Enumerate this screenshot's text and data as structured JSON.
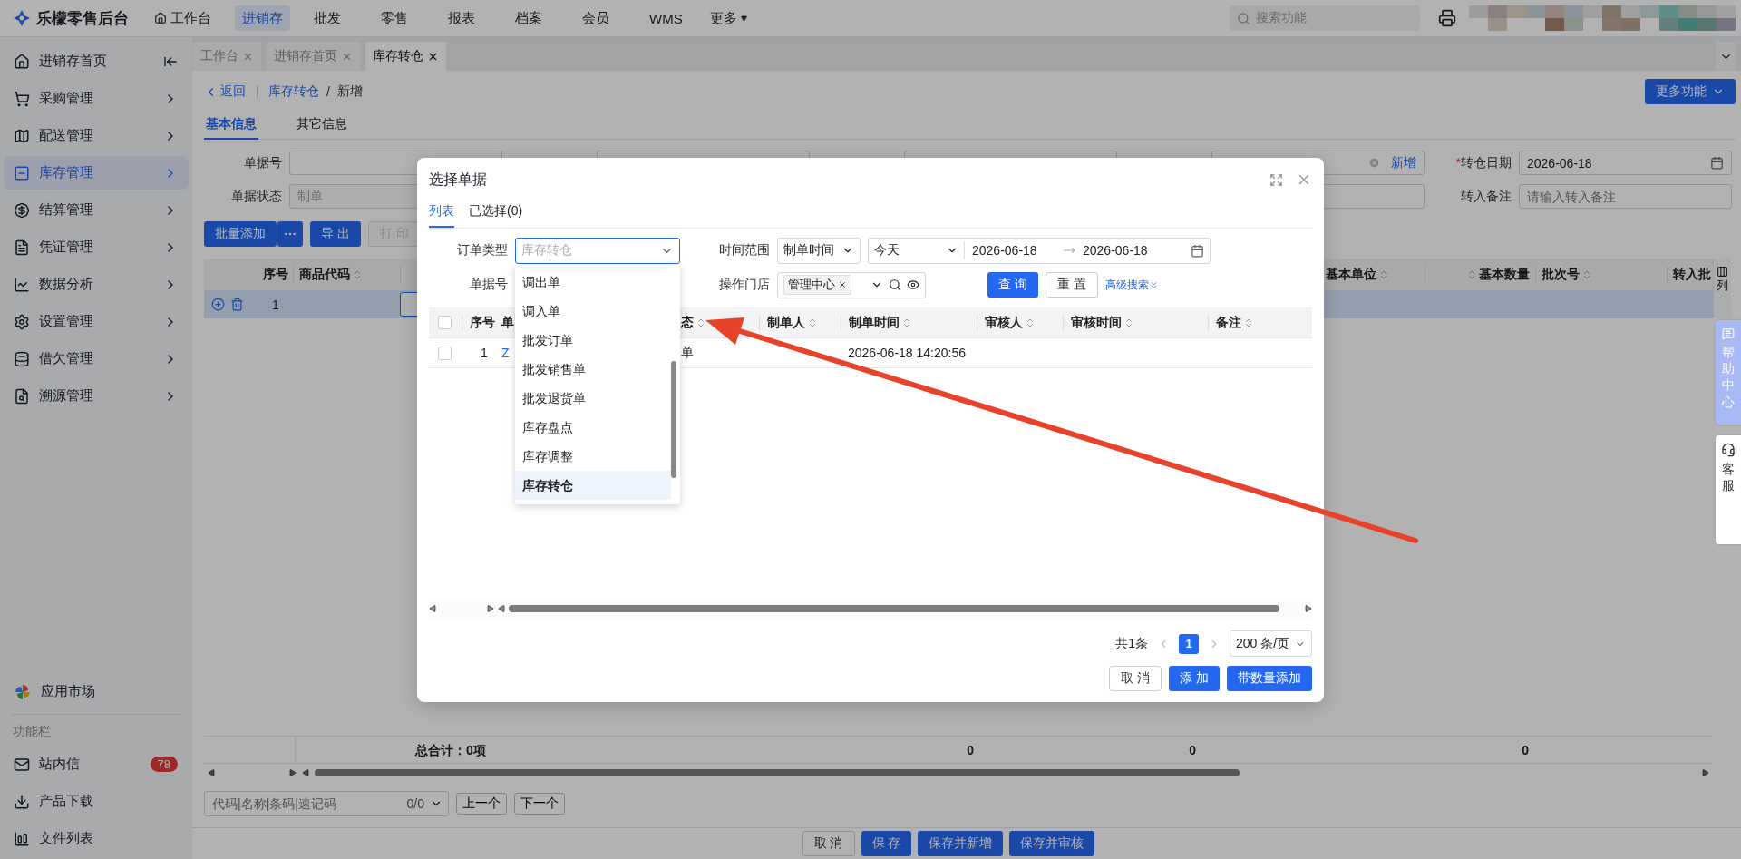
{
  "top_bar": {
    "logo_text": "乐檬零售后台",
    "nav": [
      {
        "label": "工作台",
        "selected": false
      },
      {
        "label": "进销存",
        "selected": true
      },
      {
        "label": "批发",
        "selected": false
      },
      {
        "label": "零售",
        "selected": false
      },
      {
        "label": "报表",
        "selected": false
      },
      {
        "label": "档案",
        "selected": false
      },
      {
        "label": "会员",
        "selected": false
      },
      {
        "label": "WMS",
        "selected": false
      },
      {
        "label": "更多",
        "selected": false
      }
    ],
    "search": {
      "placeholder": "搜索功能"
    }
  },
  "sidebar": {
    "items": [
      {
        "label": "进销存首页",
        "selected": false
      },
      {
        "label": "采购管理",
        "selected": false
      },
      {
        "label": "配送管理",
        "selected": false
      },
      {
        "label": "库存管理",
        "selected": true
      },
      {
        "label": "结算管理",
        "selected": false
      },
      {
        "label": "凭证管理",
        "selected": false
      },
      {
        "label": "数据分析",
        "selected": false
      },
      {
        "label": "设置管理",
        "selected": false
      },
      {
        "label": "借欠管理",
        "selected": false
      },
      {
        "label": "溯源管理",
        "selected": false
      }
    ],
    "app_market": "应用市场",
    "section_title": "功能栏",
    "tools": [
      {
        "label": "站内信",
        "badge": "78"
      },
      {
        "label": "产品下载"
      },
      {
        "label": "文件列表"
      }
    ]
  },
  "page_tabs": [
    {
      "label": "工作台",
      "selected": false
    },
    {
      "label": "进销存首页",
      "selected": false
    },
    {
      "label": "库存转仓",
      "selected": true
    }
  ],
  "breadcrumb": {
    "back": "返回",
    "parent": "库存转仓",
    "separator": "/",
    "current": "新增"
  },
  "more_button": "更多功能",
  "section_tabs": [
    {
      "label": "基本信息",
      "selected": true
    },
    {
      "label": "其它信息",
      "selected": false
    }
  ],
  "form": {
    "doc_no": {
      "label": "单据号"
    },
    "salesperson": {
      "link": "新增"
    },
    "transfer_date": {
      "required_mark": "*",
      "label": "转仓日期",
      "value": "2026-06-18"
    },
    "doc_status": {
      "label": "单据状态",
      "value": "制单",
      "disabled": true
    },
    "transfer_in_note": {
      "label": "转入备注",
      "placeholder": "请输入转入备注"
    }
  },
  "toolbar": [
    {
      "label": "批量添加",
      "kind": "split",
      "disabled": false
    },
    {
      "label": "导 出",
      "kind": "primary",
      "disabled": false
    },
    {
      "label": "打 印",
      "kind": "default",
      "disabled": true
    }
  ],
  "grid": {
    "header_left": [
      {
        "label": "序号",
        "sortable": false
      },
      {
        "label": "商品代码",
        "sortable": true
      }
    ],
    "header_right": [
      {
        "label": "基本单位",
        "sortable": true
      },
      {
        "label": "基本数量",
        "sortable": true
      },
      {
        "label": "批次号",
        "sortable": true
      },
      {
        "label": "转入批"
      }
    ],
    "column_settings": "列",
    "row": {
      "index": "1",
      "selected": true
    },
    "totals": {
      "label": "总合计：0项",
      "values": [
        "0",
        "0",
        "0"
      ]
    }
  },
  "finder": {
    "placeholder": "代码|名称|条码|速记码",
    "count": "0/0",
    "prev": "上一个",
    "next": "下一个"
  },
  "actions": [
    {
      "label": "取 消",
      "kind": "default"
    },
    {
      "label": "保 存",
      "kind": "primary"
    },
    {
      "label": "保存并新增",
      "kind": "primary"
    },
    {
      "label": "保存并审核",
      "kind": "primary"
    }
  ],
  "side_tabs": [
    {
      "label": "帮助中心",
      "kind": "help"
    },
    {
      "label": "客服",
      "kind": "service"
    }
  ],
  "dialog": {
    "title": "选择单据",
    "tabs": [
      {
        "label": "列表",
        "selected": true
      },
      {
        "label": "已选择(0)",
        "selected": false
      }
    ],
    "filters": {
      "order_type": {
        "label": "订单类型",
        "placeholder": "库存转仓"
      },
      "time_range": {
        "label": "时间范围",
        "field": "制单时间",
        "preset": "今天",
        "start": "2026-06-18",
        "end": "2026-06-18"
      },
      "doc_no": {
        "label": "单据号"
      },
      "store": {
        "label": "操作门店",
        "tag": "管理中心"
      }
    },
    "search_button": "查 询",
    "reset_button": "重 置",
    "advanced": "高级搜索",
    "table": {
      "all_checked": false,
      "columns": [
        {
          "label": "序号",
          "sortable": false
        },
        {
          "label": "单"
        },
        {
          "label": "态",
          "sortable": true
        },
        {
          "label": "制单人",
          "sortable": true
        },
        {
          "label": "制单时间",
          "sortable": true
        },
        {
          "label": "审核人",
          "sortable": true
        },
        {
          "label": "审核时间",
          "sortable": true
        },
        {
          "label": "备注",
          "sortable": true
        }
      ],
      "rows": [
        {
          "checked": false,
          "index": "1",
          "column_3": "Z",
          "column_4": "单",
          "created": "2026-06-18 14:20:56"
        }
      ]
    },
    "pagination": {
      "total": "共1条",
      "pages": [
        {
          "label": "1",
          "selected": true
        }
      ],
      "page_size": "200 条/页"
    },
    "buttons": [
      {
        "label": "取 消",
        "kind": "default"
      },
      {
        "label": "添 加",
        "kind": "primary"
      },
      {
        "label": "带数量添加",
        "kind": "primary"
      }
    ],
    "dropdown": {
      "options": [
        {
          "label": "调出单",
          "selected": false
        },
        {
          "label": "调入单",
          "selected": false
        },
        {
          "label": "批发订单",
          "selected": false
        },
        {
          "label": "批发销售单",
          "selected": false
        },
        {
          "label": "批发退货单",
          "selected": false
        },
        {
          "label": "库存盘点",
          "selected": false
        },
        {
          "label": "库存调整",
          "selected": false
        },
        {
          "label": "库存转仓",
          "selected": true
        }
      ]
    }
  }
}
